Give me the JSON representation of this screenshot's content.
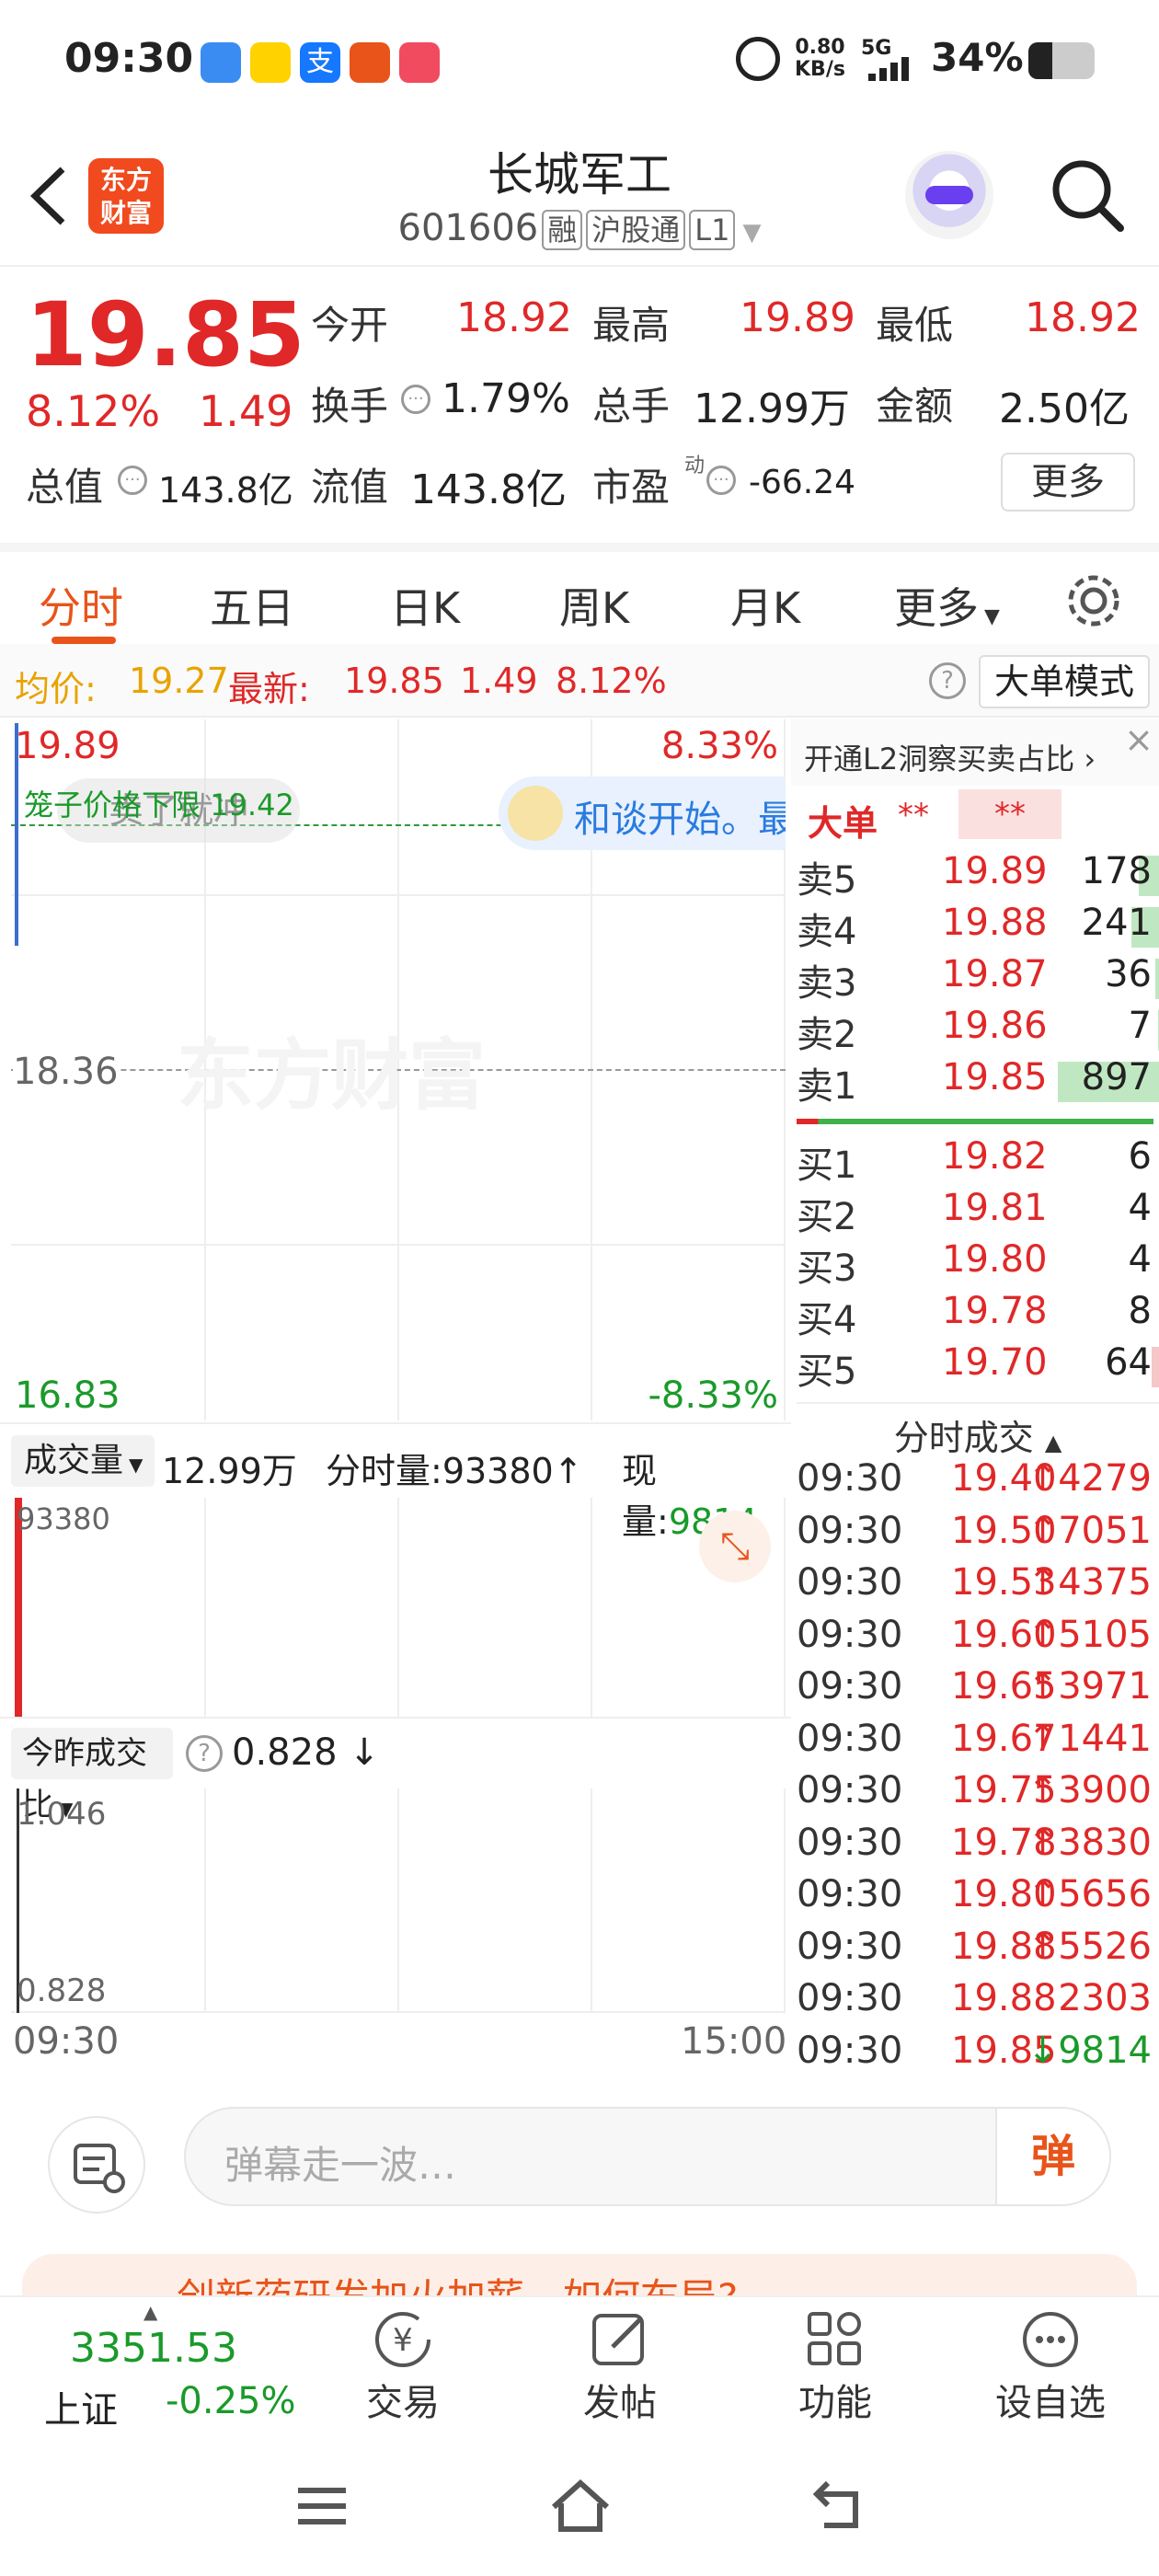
{
  "status": {
    "time": "09:30",
    "net_speed_top": "0.80",
    "net_speed_bottom": "KB/s",
    "signal": "5G",
    "battery": "34%"
  },
  "header": {
    "title": "长城军工",
    "code": "601606",
    "tags": [
      "融",
      "沪股通",
      "L1"
    ],
    "logo_line1": "东方",
    "logo_line2": "财富"
  },
  "quote": {
    "price": "19.85",
    "change_pct": "8.12%",
    "change_amt": "1.49",
    "open_label": "今开",
    "open": "18.92",
    "high_label": "最高",
    "high": "19.89",
    "low_label": "最低",
    "low": "18.92",
    "turnover_label": "换手",
    "turnover": "1.79%",
    "volume_label": "总手",
    "volume": "12.99万",
    "amount_label": "金额",
    "amount": "2.50亿",
    "mktcap_label": "总值",
    "mktcap": "143.8亿",
    "float_label": "流值",
    "float": "143.8亿",
    "pe_label": "市盈",
    "pe_sup": "动",
    "pe": "-66.24",
    "more": "更多"
  },
  "tabs": [
    "分时",
    "五日",
    "日K",
    "周K",
    "月K",
    "更多"
  ],
  "chart_info": {
    "avg_label": "均价:",
    "avg": "19.27",
    "latest_label": "最新:",
    "latest": "19.85",
    "latest_chg": "1.49",
    "latest_pct": "8.12%",
    "big_order_mode": "大单模式"
  },
  "chart": {
    "y_top": "19.89",
    "y_mid": "18.36",
    "y_bottom": "16.83",
    "pct_top": "8.33%",
    "pct_bottom": "-8.33%",
    "limit_label": "笼子价格下限",
    "limit_value": "19.42",
    "hint_text": "卖了就冲",
    "banner": "和谈开始。最",
    "watermark": "东方财富"
  },
  "volume_bar": {
    "selector": "成交量",
    "total": "12.99万",
    "minute_vol_label": "分时量:",
    "minute_vol": "93380",
    "current_label": "现量:",
    "current": "9814",
    "max_label": "93380"
  },
  "ratio_bar": {
    "selector": "今昨成交比",
    "value": "0.828",
    "top": "1.046",
    "bottom": "0.828"
  },
  "time_axis": {
    "start": "09:30",
    "end": "15:00"
  },
  "orderbook": {
    "promo": "开通L2洞察买卖占比",
    "big_label": "大单",
    "big_mask1": "**",
    "big_mask2": "**",
    "asks": [
      {
        "label": "卖5",
        "price": "19.89",
        "qty": "178",
        "bar": 0.2
      },
      {
        "label": "卖4",
        "price": "19.88",
        "qty": "241",
        "bar": 0.27
      },
      {
        "label": "卖3",
        "price": "19.87",
        "qty": "36",
        "bar": 0.04
      },
      {
        "label": "卖2",
        "price": "19.86",
        "qty": "7",
        "bar": 0.01
      },
      {
        "label": "卖1",
        "price": "19.85",
        "qty": "897",
        "bar": 1.0
      }
    ],
    "bids": [
      {
        "label": "买1",
        "price": "19.82",
        "qty": "6",
        "bar": 0.0
      },
      {
        "label": "买2",
        "price": "19.81",
        "qty": "4",
        "bar": 0.0
      },
      {
        "label": "买3",
        "price": "19.80",
        "qty": "4",
        "bar": 0.0
      },
      {
        "label": "买4",
        "price": "19.78",
        "qty": "8",
        "bar": 0.0
      },
      {
        "label": "买5",
        "price": "19.70",
        "qty": "64",
        "bar": 0.07
      }
    ],
    "trades_title": "分时成交",
    "trades": [
      {
        "time": "09:30",
        "price": "19.40",
        "dir": "↑",
        "qty": "4279"
      },
      {
        "time": "09:30",
        "price": "19.50",
        "dir": "↑",
        "qty": "7051"
      },
      {
        "time": "09:30",
        "price": "19.53",
        "dir": "↑",
        "qty": "4375"
      },
      {
        "time": "09:30",
        "price": "19.60",
        "dir": "↑",
        "qty": "5105"
      },
      {
        "time": "09:30",
        "price": "19.65",
        "dir": "↑",
        "qty": "3971"
      },
      {
        "time": "09:30",
        "price": "19.67",
        "dir": "↑",
        "qty": "1441"
      },
      {
        "time": "09:30",
        "price": "19.75",
        "dir": "↑",
        "qty": "3900"
      },
      {
        "time": "09:30",
        "price": "19.78",
        "dir": "↑",
        "qty": "3830"
      },
      {
        "time": "09:30",
        "price": "19.80",
        "dir": "↑",
        "qty": "5656"
      },
      {
        "time": "09:30",
        "price": "19.88",
        "dir": "↑",
        "qty": "5526"
      },
      {
        "time": "09:30",
        "price": "19.88",
        "dir": "",
        "qty": "2303"
      },
      {
        "time": "09:30",
        "price": "19.85",
        "dir": "↓",
        "qty": "9814"
      }
    ]
  },
  "comment": {
    "placeholder": "弹幕走一波…",
    "danmu_button": "弹"
  },
  "news": {
    "text": "创新药研发加火加薪，如何布局?"
  },
  "bottomnav": {
    "index_value": "3351.53",
    "index_name": "上证",
    "index_change": "-0.25%",
    "items": [
      "交易",
      "发帖",
      "功能",
      "设自选"
    ]
  }
}
